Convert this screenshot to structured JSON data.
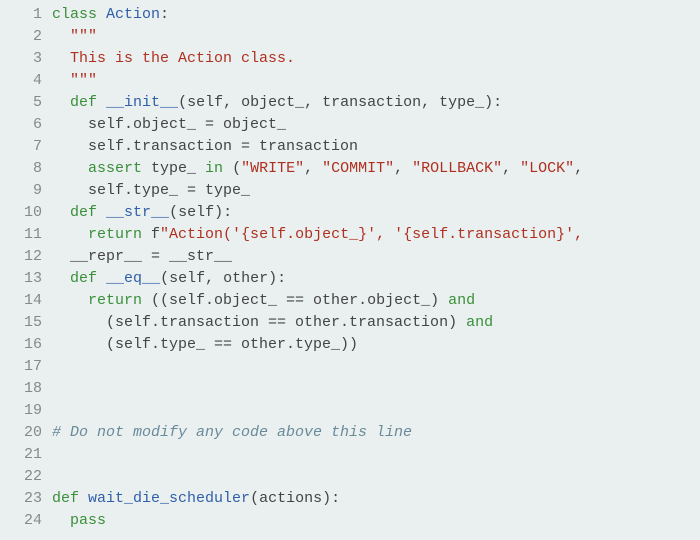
{
  "chart_data": null,
  "editor": {
    "line_count": 24,
    "lines": {
      "l1": {
        "indent": "",
        "tokens": [
          [
            "kw",
            "class"
          ],
          [
            "",
            " "
          ],
          [
            "name",
            "Action"
          ],
          [
            "",
            ":"
          ]
        ]
      },
      "l2": {
        "indent": "  ",
        "tokens": [
          [
            "str",
            "\"\"\""
          ]
        ]
      },
      "l3": {
        "indent": "  ",
        "tokens": [
          [
            "str",
            "This is the Action class."
          ]
        ]
      },
      "l4": {
        "indent": "  ",
        "tokens": [
          [
            "str",
            "\"\"\""
          ]
        ]
      },
      "l5": {
        "indent": "  ",
        "tokens": [
          [
            "kw",
            "def"
          ],
          [
            "",
            " "
          ],
          [
            "fn",
            "__init__"
          ],
          [
            "",
            "(self, object_, transaction, type_):"
          ]
        ]
      },
      "l6": {
        "indent": "    ",
        "tokens": [
          [
            "",
            "self.object_ = object_"
          ]
        ]
      },
      "l7": {
        "indent": "    ",
        "tokens": [
          [
            "",
            "self.transaction = transaction"
          ]
        ]
      },
      "l8": {
        "indent": "    ",
        "tokens": [
          [
            "kw",
            "assert"
          ],
          [
            "",
            " type_ "
          ],
          [
            "kw",
            "in"
          ],
          [
            "",
            " ("
          ],
          [
            "str",
            "\"WRITE\""
          ],
          [
            "",
            ", "
          ],
          [
            "str",
            "\"COMMIT\""
          ],
          [
            "",
            ", "
          ],
          [
            "str",
            "\"ROLLBACK\""
          ],
          [
            "",
            ", "
          ],
          [
            "str",
            "\"LOCK\""
          ],
          [
            "",
            ","
          ]
        ]
      },
      "l9": {
        "indent": "    ",
        "tokens": [
          [
            "",
            "self.type_ = type_"
          ]
        ]
      },
      "l10": {
        "indent": "  ",
        "tokens": [
          [
            "kw",
            "def"
          ],
          [
            "",
            " "
          ],
          [
            "fn",
            "__str__"
          ],
          [
            "",
            "(self):"
          ]
        ]
      },
      "l11": {
        "indent": "    ",
        "tokens": [
          [
            "kw",
            "return"
          ],
          [
            "",
            " f"
          ],
          [
            "str",
            "\"Action('{self.object_}', '{self.transaction}',"
          ]
        ]
      },
      "l12": {
        "indent": "  ",
        "tokens": [
          [
            "",
            "__repr__ = __str__"
          ]
        ]
      },
      "l13": {
        "indent": "  ",
        "tokens": [
          [
            "kw",
            "def"
          ],
          [
            "",
            " "
          ],
          [
            "fn",
            "__eq__"
          ],
          [
            "",
            "(self, other):"
          ]
        ]
      },
      "l14": {
        "indent": "    ",
        "tokens": [
          [
            "kw",
            "return"
          ],
          [
            "",
            " ((self.object_ == other.object_) "
          ],
          [
            "kw",
            "and"
          ]
        ]
      },
      "l15": {
        "indent": "      ",
        "tokens": [
          [
            "",
            "(self.transaction == other.transaction) "
          ],
          [
            "kw",
            "and"
          ]
        ]
      },
      "l16": {
        "indent": "      ",
        "tokens": [
          [
            "",
            "(self.type_ == other.type_))"
          ]
        ]
      },
      "l17": {
        "indent": "",
        "tokens": [
          [
            "",
            ""
          ]
        ]
      },
      "l18": {
        "indent": "",
        "tokens": [
          [
            "",
            ""
          ]
        ]
      },
      "l19": {
        "indent": "",
        "tokens": [
          [
            "",
            ""
          ]
        ]
      },
      "l20": {
        "indent": "",
        "tokens": [
          [
            "com",
            "# Do not modify any code above this line"
          ]
        ]
      },
      "l21": {
        "indent": "",
        "tokens": [
          [
            "",
            ""
          ]
        ]
      },
      "l22": {
        "indent": "",
        "tokens": [
          [
            "",
            ""
          ]
        ]
      },
      "l23": {
        "indent": "",
        "tokens": [
          [
            "kw",
            "def"
          ],
          [
            "",
            " "
          ],
          [
            "fn",
            "wait_die_scheduler"
          ],
          [
            "",
            "(actions):"
          ]
        ]
      },
      "l24": {
        "indent": "  ",
        "tokens": [
          [
            "kw",
            "pass"
          ]
        ]
      }
    }
  }
}
